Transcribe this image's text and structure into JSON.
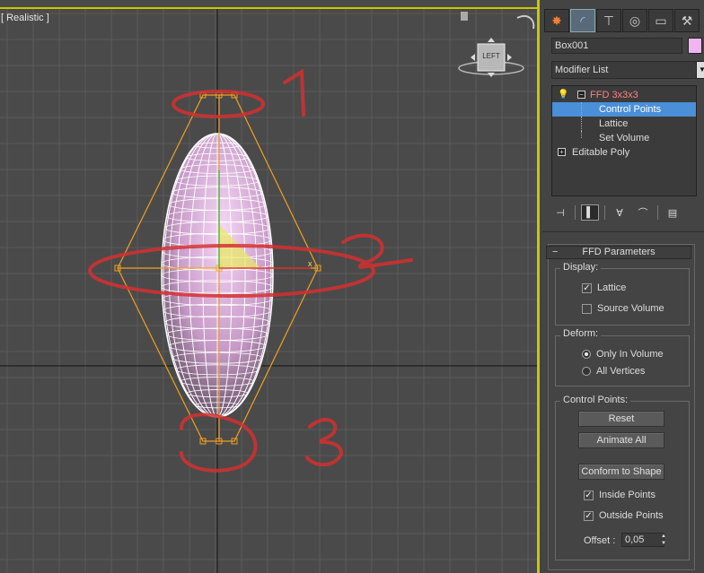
{
  "viewport": {
    "label": "[ Realistic ]",
    "viewcube_label": "LEFT",
    "annotations": [
      "1",
      "2",
      "3"
    ]
  },
  "panel": {
    "tabs": [
      {
        "name": "create-tab",
        "glyph": "✸"
      },
      {
        "name": "modify-tab",
        "glyph": "◜"
      },
      {
        "name": "hierarchy-tab",
        "glyph": "⊤"
      },
      {
        "name": "motion-tab",
        "glyph": "◎"
      },
      {
        "name": "display-tab",
        "glyph": "▭"
      },
      {
        "name": "utilities-tab",
        "glyph": "⚒"
      }
    ],
    "object_name": "Box001",
    "object_color": "#f0b4f0",
    "modifier_list": "Modifier List",
    "stack": {
      "ffd": "FFD 3x3x3",
      "control_points": "Control Points",
      "lattice": "Lattice",
      "set_volume": "Set Volume",
      "editable_poly": "Editable Poly"
    },
    "rollout": {
      "title": "FFD Parameters",
      "display": {
        "title": "Display:",
        "lattice": "Lattice",
        "lattice_checked": true,
        "source_volume": "Source Volume",
        "source_volume_checked": false
      },
      "deform": {
        "title": "Deform:",
        "only_in_volume": "Only In Volume",
        "only_in_volume_selected": true,
        "all_vertices": "All Vertices",
        "all_vertices_selected": false
      },
      "control_points": {
        "title": "Control Points:",
        "reset": "Reset",
        "animate_all": "Animate All",
        "conform_to_shape": "Conform to Shape",
        "inside_points": "Inside Points",
        "inside_points_checked": true,
        "outside_points": "Outside Points",
        "outside_points_checked": true,
        "offset_label": "Offset :",
        "offset_value": "0,05"
      }
    }
  }
}
